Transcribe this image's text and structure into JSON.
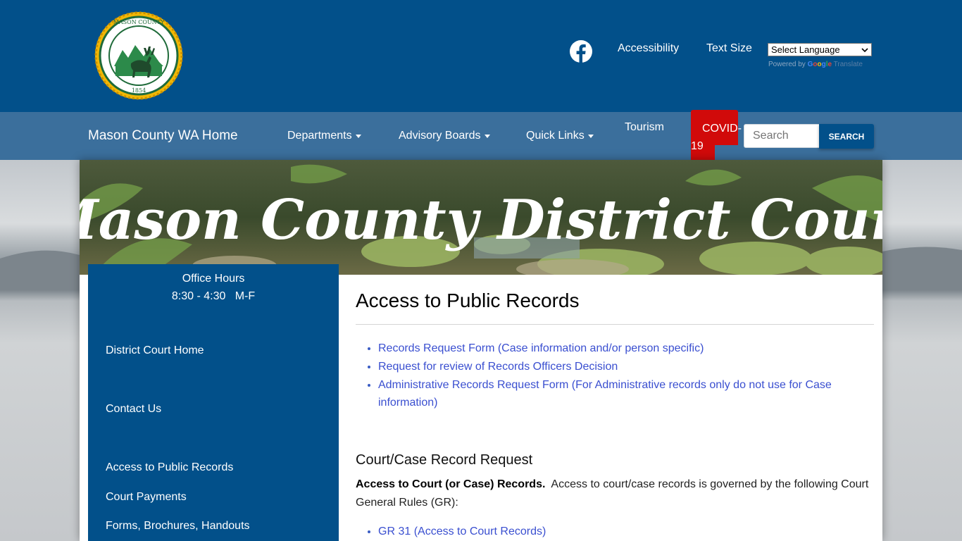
{
  "header": {
    "seal": {
      "top_text": "MASON COUNTY",
      "year": "1854"
    },
    "facebook_icon": "facebook-icon",
    "accessibility": "Accessibility",
    "text_size": "Text Size",
    "language_select": "Select Language",
    "powered_by": "Powered by",
    "google": [
      "G",
      "o",
      "o",
      "g",
      "l",
      "e"
    ],
    "translate": "Translate"
  },
  "nav": {
    "home": "Mason County WA Home",
    "departments": "Departments",
    "advisory_boards": "Advisory Boards",
    "quick_links": "Quick Links",
    "tourism": "Tourism",
    "covid": "COVID-19",
    "search_placeholder": "Search",
    "search_button": "SEARCH"
  },
  "banner": {
    "title": "Mason County District Court"
  },
  "sidebar": {
    "hours_title": "Office Hours",
    "hours_value": "8:30 - 4:30   M-F",
    "items": [
      {
        "label": "District Court Home"
      },
      {
        "label": "Contact Us"
      },
      {
        "label": "Access to Public Records"
      },
      {
        "label": "Court Payments"
      },
      {
        "label": "Forms, Brochures, Handouts"
      }
    ]
  },
  "main": {
    "title": "Access to Public Records",
    "links": [
      "Records Request Form (Case information and/or person specific)",
      "Request for review of Records Officers Decision",
      "Administrative Records Request Form (For Administrative records only do not use for Case information)"
    ],
    "section_title": "Court/Case Record Request",
    "para_bold": "Access to Court (or Case) Records.",
    "para_text": "Access to court/case records is governed by the following Court General Rules (GR):",
    "gr_links": [
      "GR 31 (Access to Court Records)"
    ]
  },
  "colors": {
    "header_blue": "#02508a",
    "nav_blue": "#3b6f9c",
    "covid_red": "#d10a0a",
    "link": "#3a4fd0"
  }
}
